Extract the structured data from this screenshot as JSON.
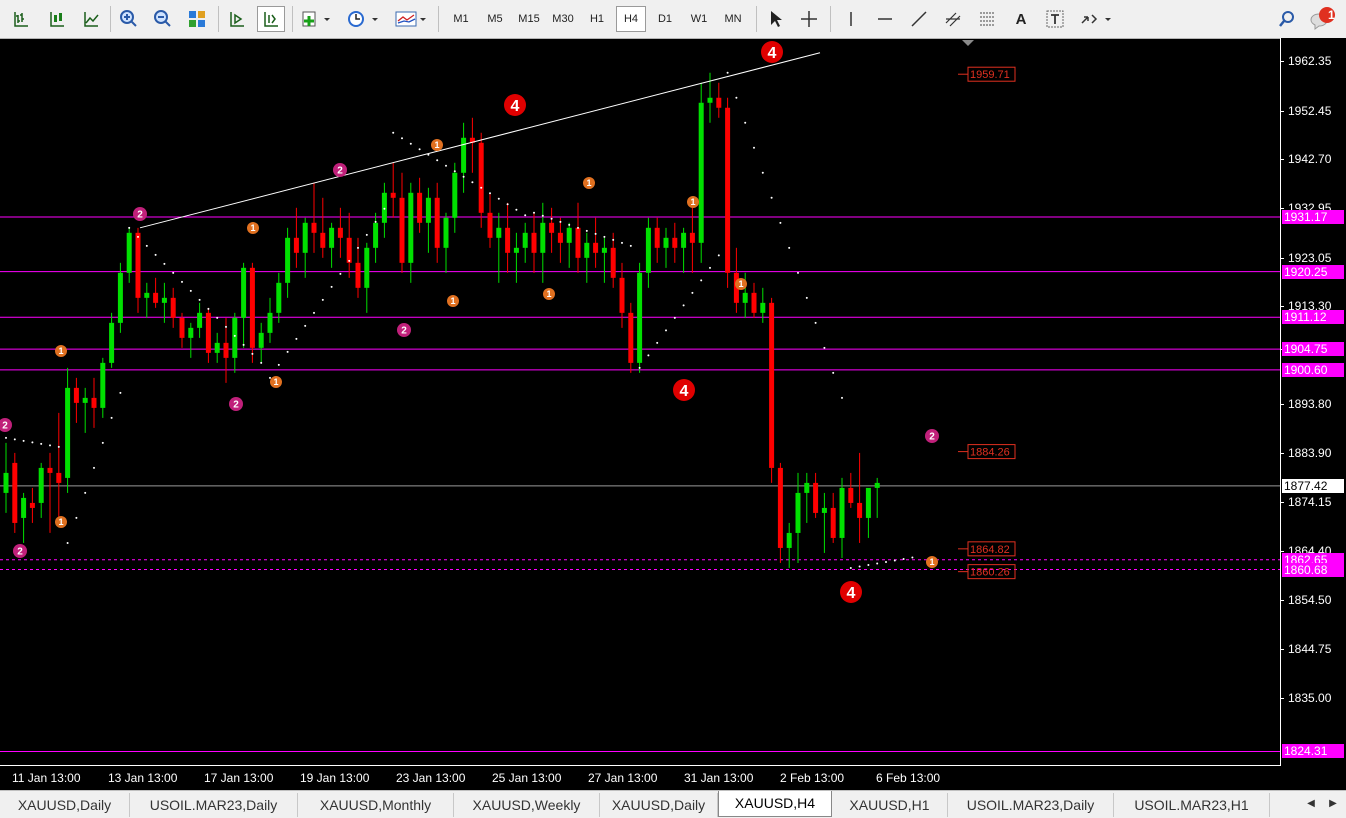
{
  "toolbar": {
    "timeframes": [
      "M1",
      "M5",
      "M15",
      "M30",
      "H1",
      "H4",
      "D1",
      "W1",
      "MN"
    ],
    "active_timeframe": "H4",
    "alert_count": "1",
    "text_tool_label": "A"
  },
  "chart": {
    "symbol": "XAUUSD",
    "period": "H4",
    "colors": {
      "bull": "#00e000",
      "bear": "#ff0000",
      "hline": "#ff00ff",
      "grid": "#ffffff"
    },
    "price_ticks": [
      "1962.35",
      "1952.45",
      "1942.70",
      "1932.95",
      "1923.05",
      "1913.30",
      "1904.75",
      "1893.80",
      "1883.90",
      "1874.15",
      "1864.40",
      "1854.50",
      "1844.75",
      "1835.00"
    ],
    "hline_labels": [
      "1931.17",
      "1920.25",
      "1911.12",
      "1904.75",
      "1900.60",
      "1862.65",
      "1860.68",
      "1824.31"
    ],
    "current_price": "1877.42",
    "bracket_labels": [
      "1959.71",
      "1884.26",
      "1864.82",
      "1860.26"
    ],
    "time_labels": [
      "11 Jan 13:00",
      "13 Jan 13:00",
      "17 Jan 13:00",
      "19 Jan 13:00",
      "23 Jan 13:00",
      "25 Jan 13:00",
      "27 Jan 13:00",
      "31 Jan 13:00",
      "2 Feb 13:00",
      "6 Feb 13:00"
    ],
    "wave_labels_major": [
      "4",
      "4",
      "4",
      "4"
    ],
    "wave_labels_minor2": [
      "2",
      "2",
      "2",
      "2",
      "2",
      "2",
      "2"
    ],
    "wave_labels_minor1": [
      "1",
      "1",
      "1",
      "1",
      "1",
      "1",
      "1",
      "1",
      "1",
      "1",
      "1"
    ]
  },
  "tabs": [
    "XAUUSD,Daily",
    "USOIL.MAR23,Daily",
    "XAUUSD,Monthly",
    "XAUUSD,Weekly",
    "XAUUSD,Daily",
    "XAUUSD,H4",
    "XAUUSD,H1",
    "USOIL.MAR23,Daily",
    "USOIL.MAR23,H1"
  ],
  "active_tab": "XAUUSD,H4"
}
